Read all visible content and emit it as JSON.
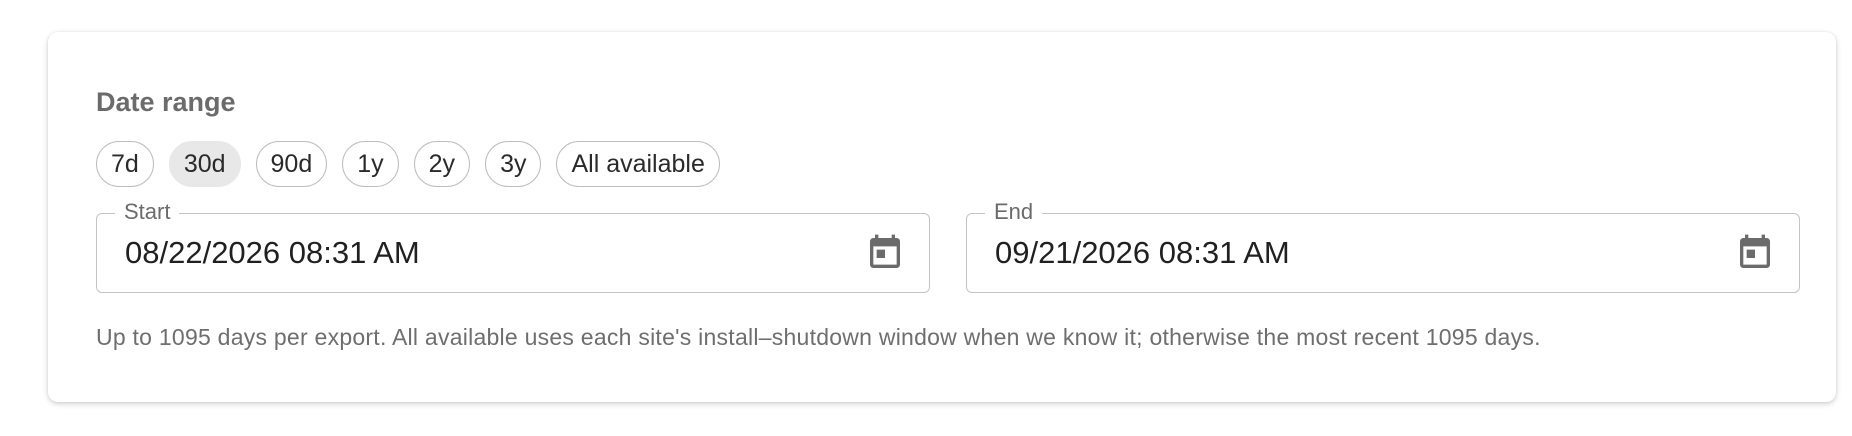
{
  "date_range": {
    "title": "Date range",
    "presets": [
      {
        "label": "7d",
        "selected": false
      },
      {
        "label": "30d",
        "selected": true
      },
      {
        "label": "90d",
        "selected": false
      },
      {
        "label": "1y",
        "selected": false
      },
      {
        "label": "2y",
        "selected": false
      },
      {
        "label": "3y",
        "selected": false
      },
      {
        "label": "All available",
        "selected": false
      }
    ],
    "start": {
      "label": "Start",
      "value": "08/22/2026 08:31 AM",
      "icon": "calendar-icon"
    },
    "end": {
      "label": "End",
      "value": "09/21/2026 08:31 AM",
      "icon": "calendar-icon"
    },
    "helper_text": "Up to 1095 days per export. All available uses each site's install–shutdown window when we know it; otherwise the most recent 1095 days."
  },
  "colors": {
    "selected_chip_bg": "#e8e8e8",
    "chip_border": "#bdbdbd",
    "icon": "#6b6b6b"
  }
}
